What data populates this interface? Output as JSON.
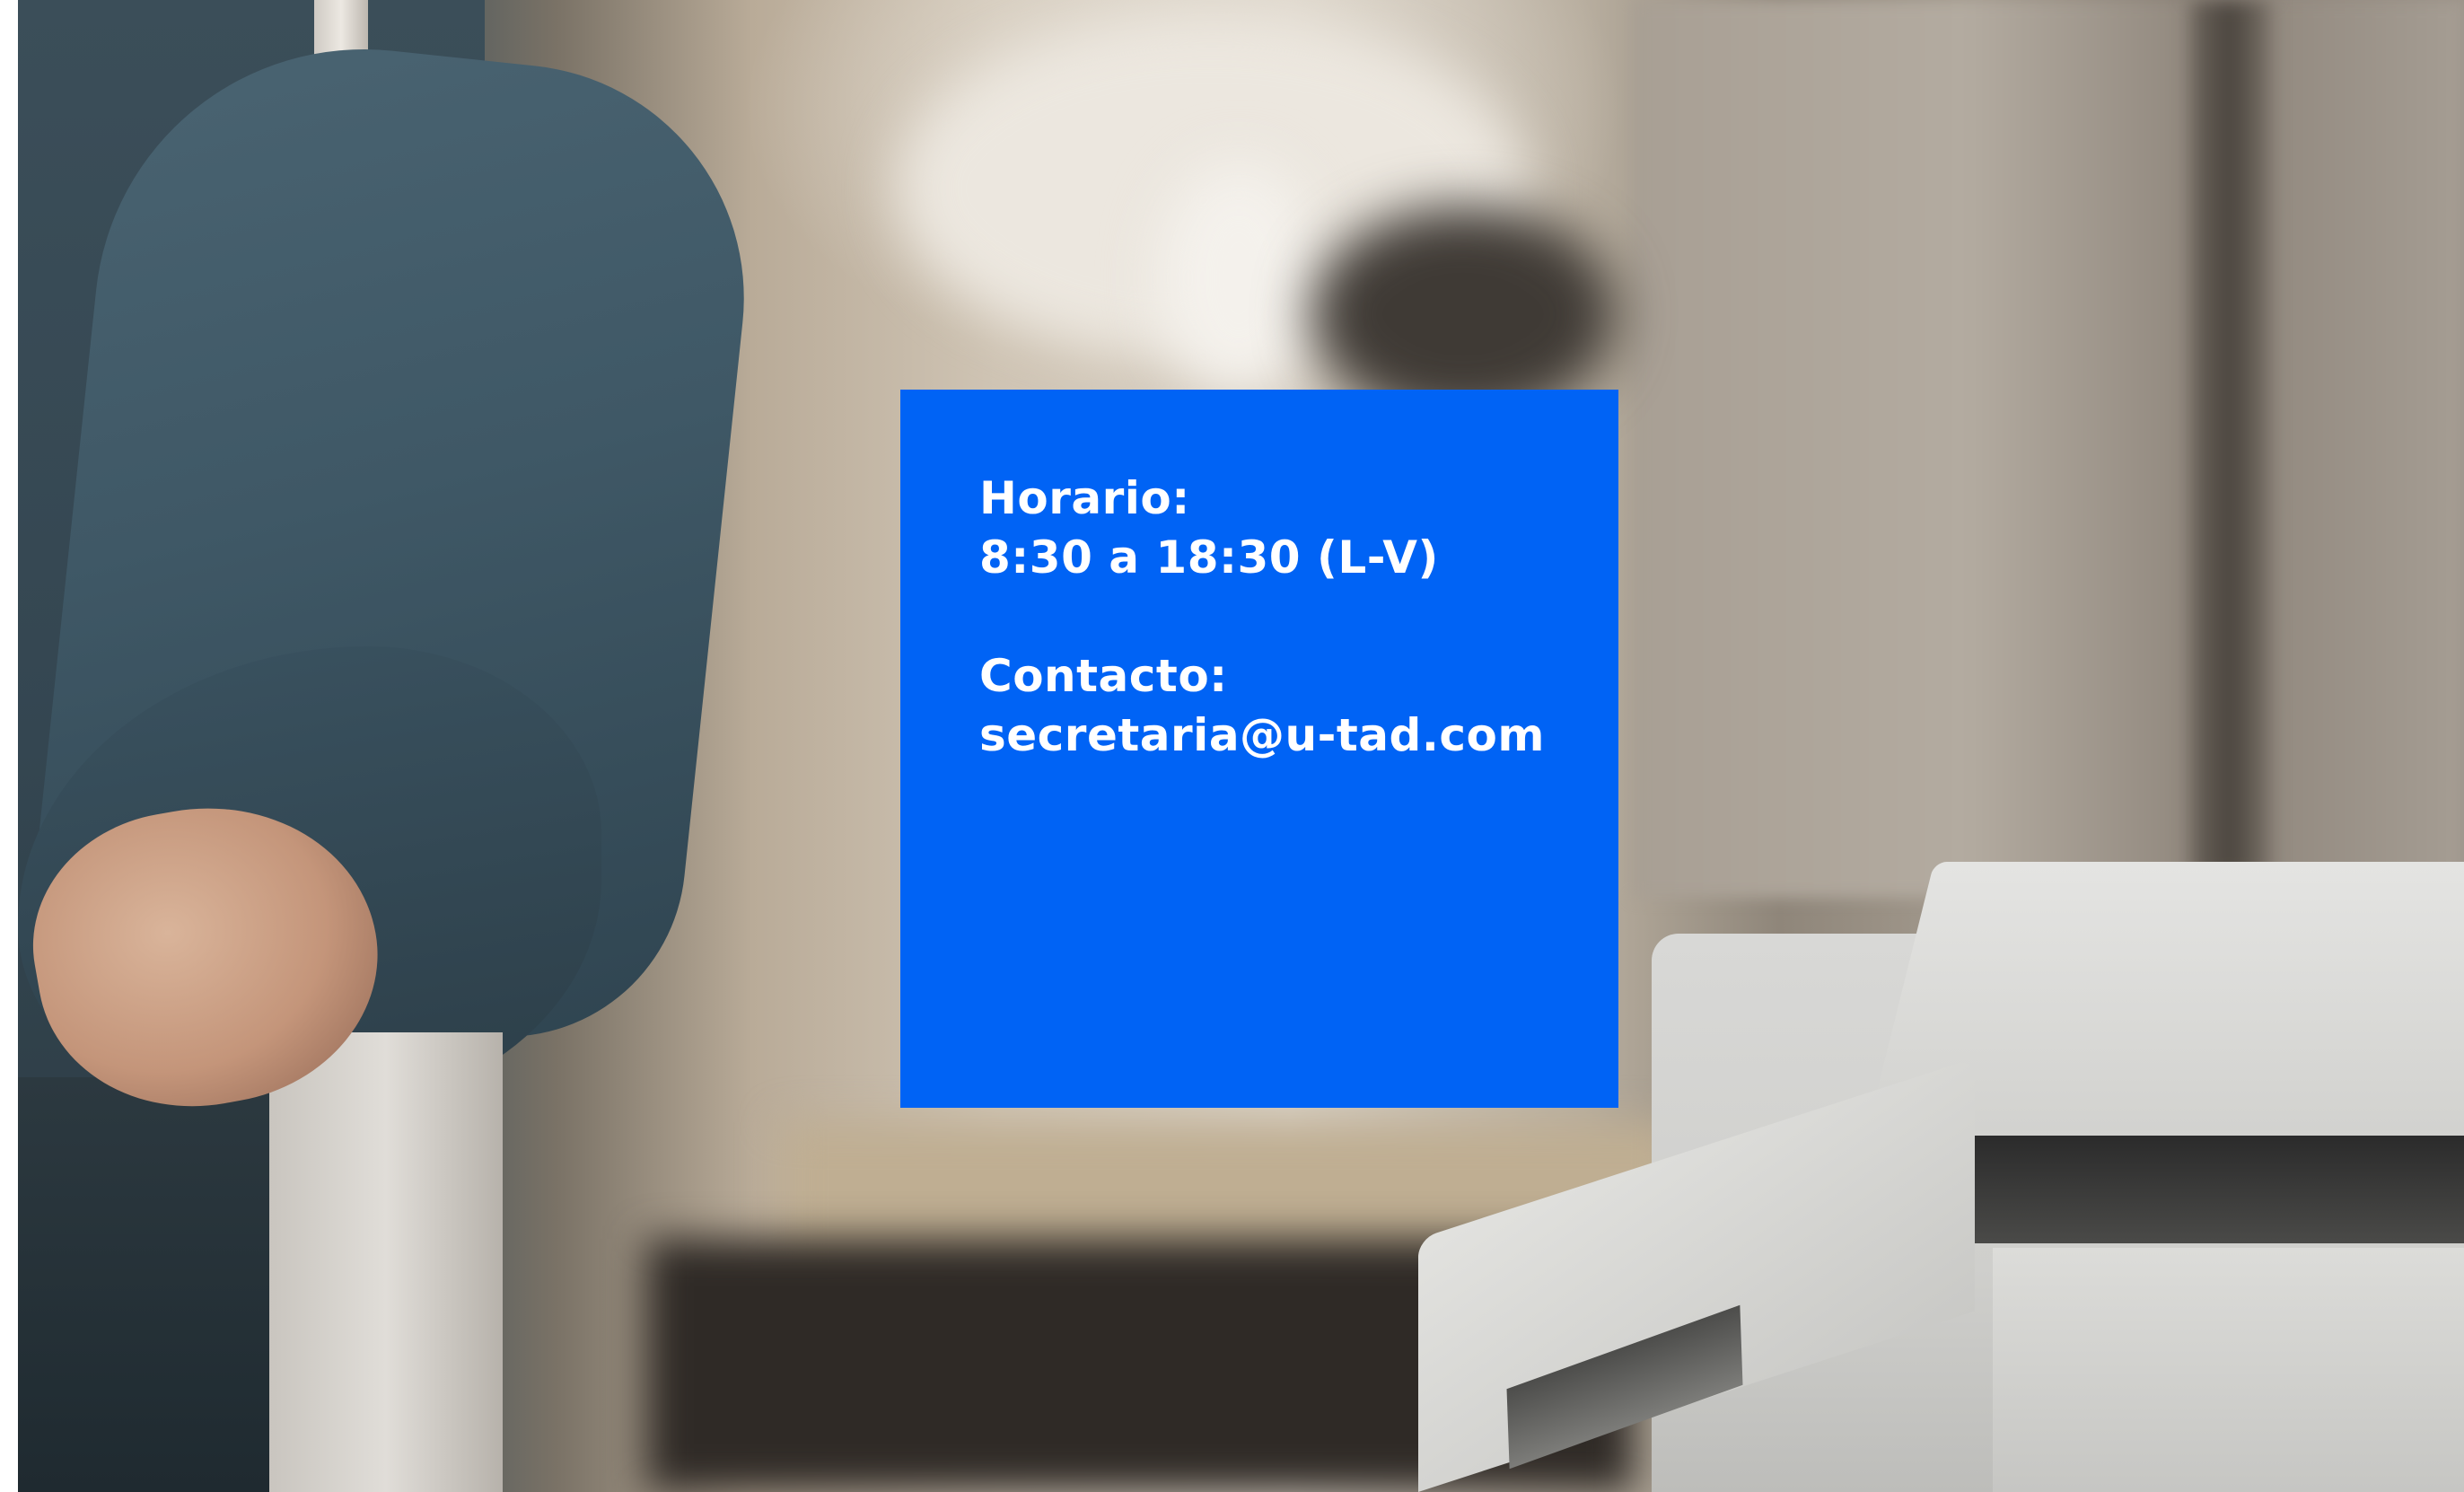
{
  "card": {
    "schedule_label": "Horario:",
    "schedule_value": "8:30 a 18:30 (L-V)",
    "contact_label": "Contacto:",
    "contact_value": "secretaria@u-tad.com"
  },
  "colors": {
    "card_background": "#0063f5",
    "card_text": "#ffffff"
  }
}
